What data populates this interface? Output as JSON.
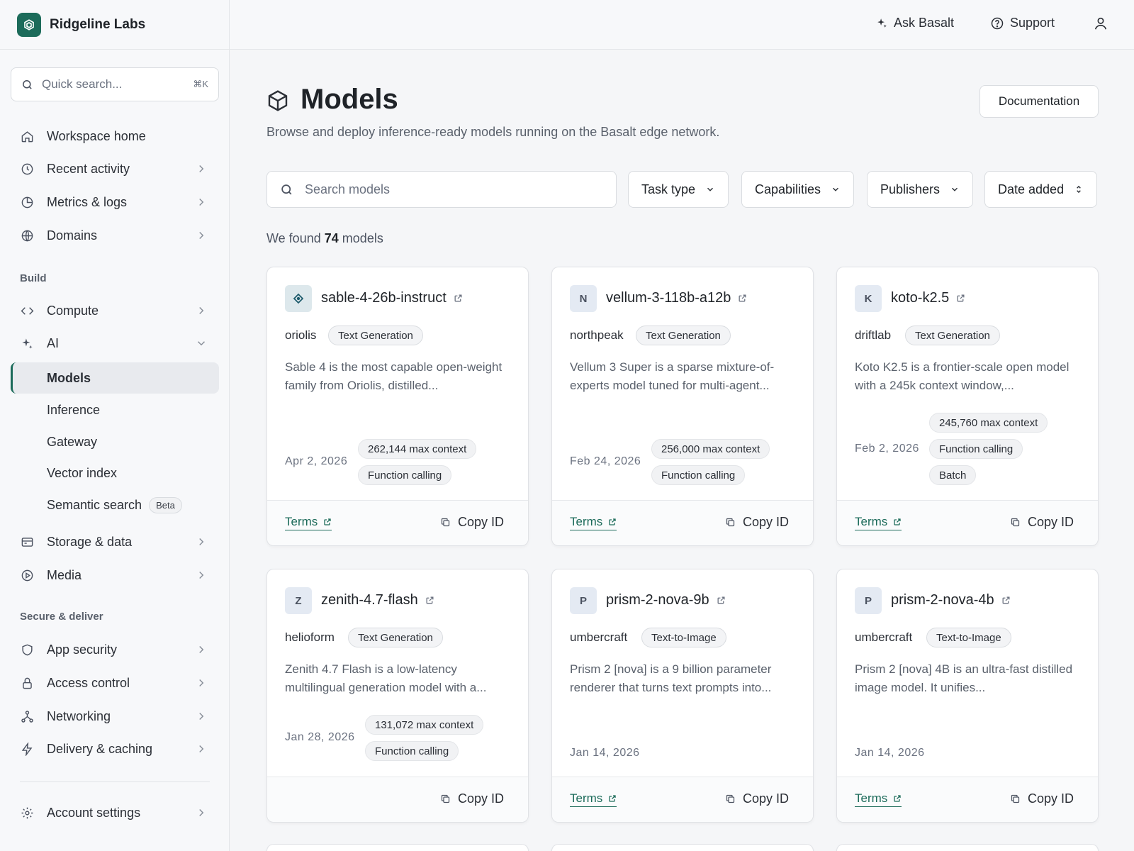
{
  "brand": {
    "name": "Ridgeline Labs"
  },
  "quick_search": {
    "placeholder": "Quick search...",
    "shortcut": "⌘K"
  },
  "nav": {
    "workspace_home": "Workspace home",
    "recent_activity": "Recent activity",
    "metrics_logs": "Metrics & logs",
    "domains": "Domains",
    "section_build": "Build",
    "compute": "Compute",
    "ai": "AI",
    "ai_sub": {
      "models": "Models",
      "inference": "Inference",
      "gateway": "Gateway",
      "vector_index": "Vector index",
      "semantic_search": "Semantic search",
      "semantic_badge": "Beta"
    },
    "storage_data": "Storage & data",
    "media": "Media",
    "section_secure": "Secure & deliver",
    "app_security": "App security",
    "access_control": "Access control",
    "networking": "Networking",
    "delivery_caching": "Delivery & caching",
    "account_settings": "Account settings"
  },
  "topbar": {
    "ask": "Ask Basalt",
    "support": "Support"
  },
  "page": {
    "title": "Models",
    "subtitle": "Browse and deploy inference-ready models running on the Basalt edge network.",
    "documentation": "Documentation",
    "search_placeholder": "Search models",
    "filters": [
      "Task type",
      "Capabilities",
      "Publishers",
      "Date added"
    ],
    "found_prefix": "We found",
    "found_count": "74",
    "found_suffix": "models"
  },
  "card_labels": {
    "terms": "Terms",
    "copy_id": "Copy ID"
  },
  "cards": [
    {
      "avatar": "",
      "name": "sable-4-26b-instruct",
      "publisher": "oriolis",
      "task": "Text Generation",
      "desc": "Sable 4 is the most capable open-weight family from Oriolis, distilled...",
      "date": "Apr 2, 2026",
      "chips": [
        "262,144 max context",
        "Function calling"
      ]
    },
    {
      "avatar": "N",
      "name": "vellum-3-118b-a12b",
      "publisher": "northpeak",
      "task": "Text Generation",
      "desc": "Vellum 3 Super is a sparse mixture-of-experts model tuned for multi-agent...",
      "date": "Feb 24, 2026",
      "chips": [
        "256,000 max context",
        "Function calling"
      ]
    },
    {
      "avatar": "K",
      "name": "koto-k2.5",
      "publisher": "driftlab",
      "task": "Text Generation",
      "desc": "Koto K2.5 is a frontier-scale open model with a 245k context window,...",
      "date": "Feb 2, 2026",
      "chips": [
        "245,760 max context",
        "Function calling",
        "Batch"
      ]
    },
    {
      "avatar": "Z",
      "name": "zenith-4.7-flash",
      "publisher": "helioform",
      "task": "Text Generation",
      "desc": "Zenith 4.7 Flash is a low-latency multilingual generation model with a...",
      "date": "Jan 28, 2026",
      "chips": [
        "131,072 max context",
        "Function calling"
      ]
    },
    {
      "avatar": "P",
      "name": "prism-2-nova-9b",
      "publisher": "umbercraft",
      "task": "Text-to-Image",
      "desc": "Prism 2 [nova] is a 9 billion parameter renderer that turns text prompts into...",
      "date": "Jan 14, 2026",
      "chips": []
    },
    {
      "avatar": "P",
      "name": "prism-2-nova-4b",
      "publisher": "umbercraft",
      "task": "Text-to-Image",
      "desc": "Prism 2 [nova] 4B is an ultra-fast distilled image model. It unifies...",
      "date": "Jan 14, 2026",
      "chips": []
    }
  ],
  "colors": {
    "accent": "#1c6b5a"
  }
}
